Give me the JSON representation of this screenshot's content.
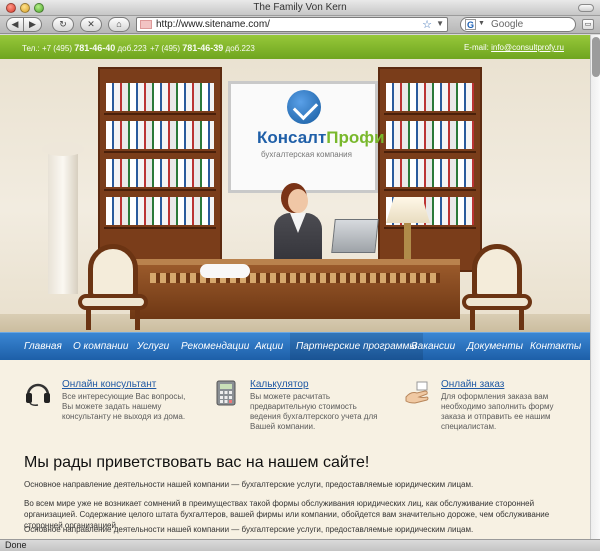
{
  "window": {
    "title": "The Family Von Kern"
  },
  "toolbar": {
    "back_icon": "◀",
    "forward_icon": "▶",
    "reload_icon": "↻",
    "stop_icon": "✕",
    "home_icon": "⌂",
    "url": "http://www.sitename.com/",
    "search_placeholder": "Google"
  },
  "header": {
    "phone1_prefix": "Тел.: +7 (495) ",
    "phone1_bold": "781-46-40",
    "phone1_suffix": " доб.223",
    "phone2_prefix": "+7 (495) ",
    "phone2_bold": "781-46-39",
    "phone2_suffix": " доб.223",
    "email_label": "E-mail: ",
    "email": "info@consultprofy.ru"
  },
  "logo": {
    "part1": "Консалт",
    "part2": "Профи",
    "subtitle": "бухгалтерская компания"
  },
  "nav": {
    "items": [
      "Главная",
      "О компании",
      "Услуги",
      "Рекомендации",
      "Акции",
      "Партнерские программы",
      "Вакансии",
      "Документы",
      "Контакты"
    ],
    "active": "Партнерские программы"
  },
  "features": [
    {
      "icon": "headset-icon",
      "title": "Онлайн консультант",
      "text": "Все интересующие Вас вопросы, Вы можете задать нашему консультанту не выходя из дома."
    },
    {
      "icon": "calculator-icon",
      "title": "Калькулятор",
      "text": "Вы можете расчитать предварительную стоимость ведения бухгалтерского учета для Вашей компании."
    },
    {
      "icon": "order-hand-icon",
      "title": "Онлайн заказ",
      "text": "Для оформления заказа вам необходимо заполнить форму заказа и отправить ее нашим специалистам."
    }
  ],
  "main": {
    "welcome": "Мы рады приветствовать вас на нашем сайте!",
    "paragraphs": [
      "Основное направление деятельности нашей компании — бухгалтерские услуги, предоставляемые юридическим лицам.",
      "Во всем мире уже не возникает сомнений в преимуществах такой формы обслуживания юридических лиц, как обслуживание сторонней организацией. Содержание целого штата бухгалтеров, вашей фирмы или компании, обойдется вам значительно дороже, чем обслуживание сторонней организацией.",
      "Основное направление деятельности нашей компании — бухгалтерские услуги, предоставляемые юридическим лицам."
    ]
  },
  "status": {
    "text": "Done"
  },
  "colors": {
    "green_bar": "#7cb32a",
    "nav_blue": "#2a74c0",
    "link_blue": "#1f58a3"
  }
}
